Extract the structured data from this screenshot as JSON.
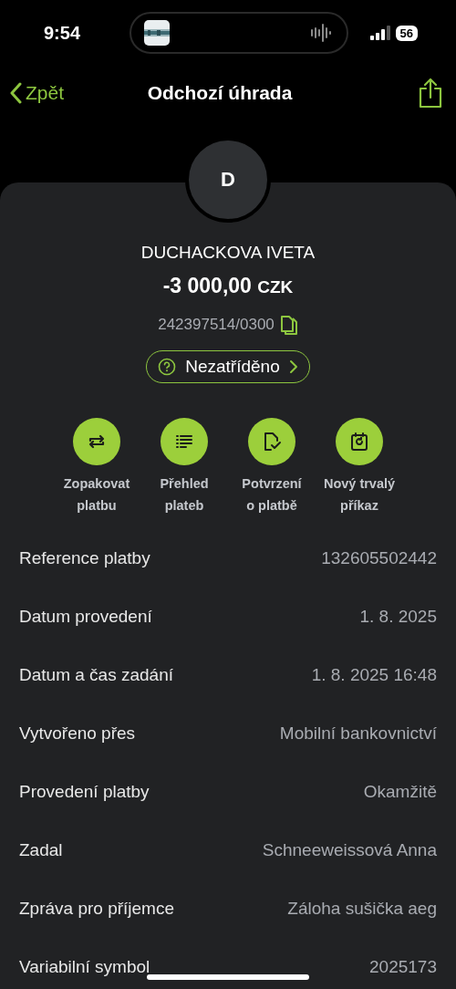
{
  "status_bar": {
    "time": "9:54",
    "battery": "56"
  },
  "nav": {
    "back": "Zpět",
    "title": "Odchozí úhrada"
  },
  "payee": {
    "initial": "D",
    "name": "DUCHACKOVA IVETA",
    "amount": "-3 000,00",
    "currency": "CZK",
    "account": "242397514/0300"
  },
  "category": {
    "label": "Nezatříděno"
  },
  "actions": [
    {
      "kind": "repeat",
      "label": "Zopakovat\nplatbu"
    },
    {
      "kind": "list",
      "label": "Přehled\nplateb"
    },
    {
      "kind": "confirm",
      "label": "Potvrzení\no platbě"
    },
    {
      "kind": "standing",
      "label": "Nový trvalý\npříkaz"
    }
  ],
  "details": [
    {
      "label": "Reference platby",
      "value": "132605502442"
    },
    {
      "label": "Datum provedení",
      "value": "1. 8. 2025"
    },
    {
      "label": "Datum a čas zadání",
      "value": "1. 8. 2025 16:48"
    },
    {
      "label": "Vytvořeno přes",
      "value": "Mobilní bankovnictví"
    },
    {
      "label": "Provedení platby",
      "value": "Okamžitě"
    },
    {
      "label": "Zadal",
      "value": "Schneeweissová Anna"
    },
    {
      "label": "Zpráva pro příjemce",
      "value": "Záloha sušička aeg"
    },
    {
      "label": "Variabilní symbol",
      "value": "2025173"
    }
  ]
}
